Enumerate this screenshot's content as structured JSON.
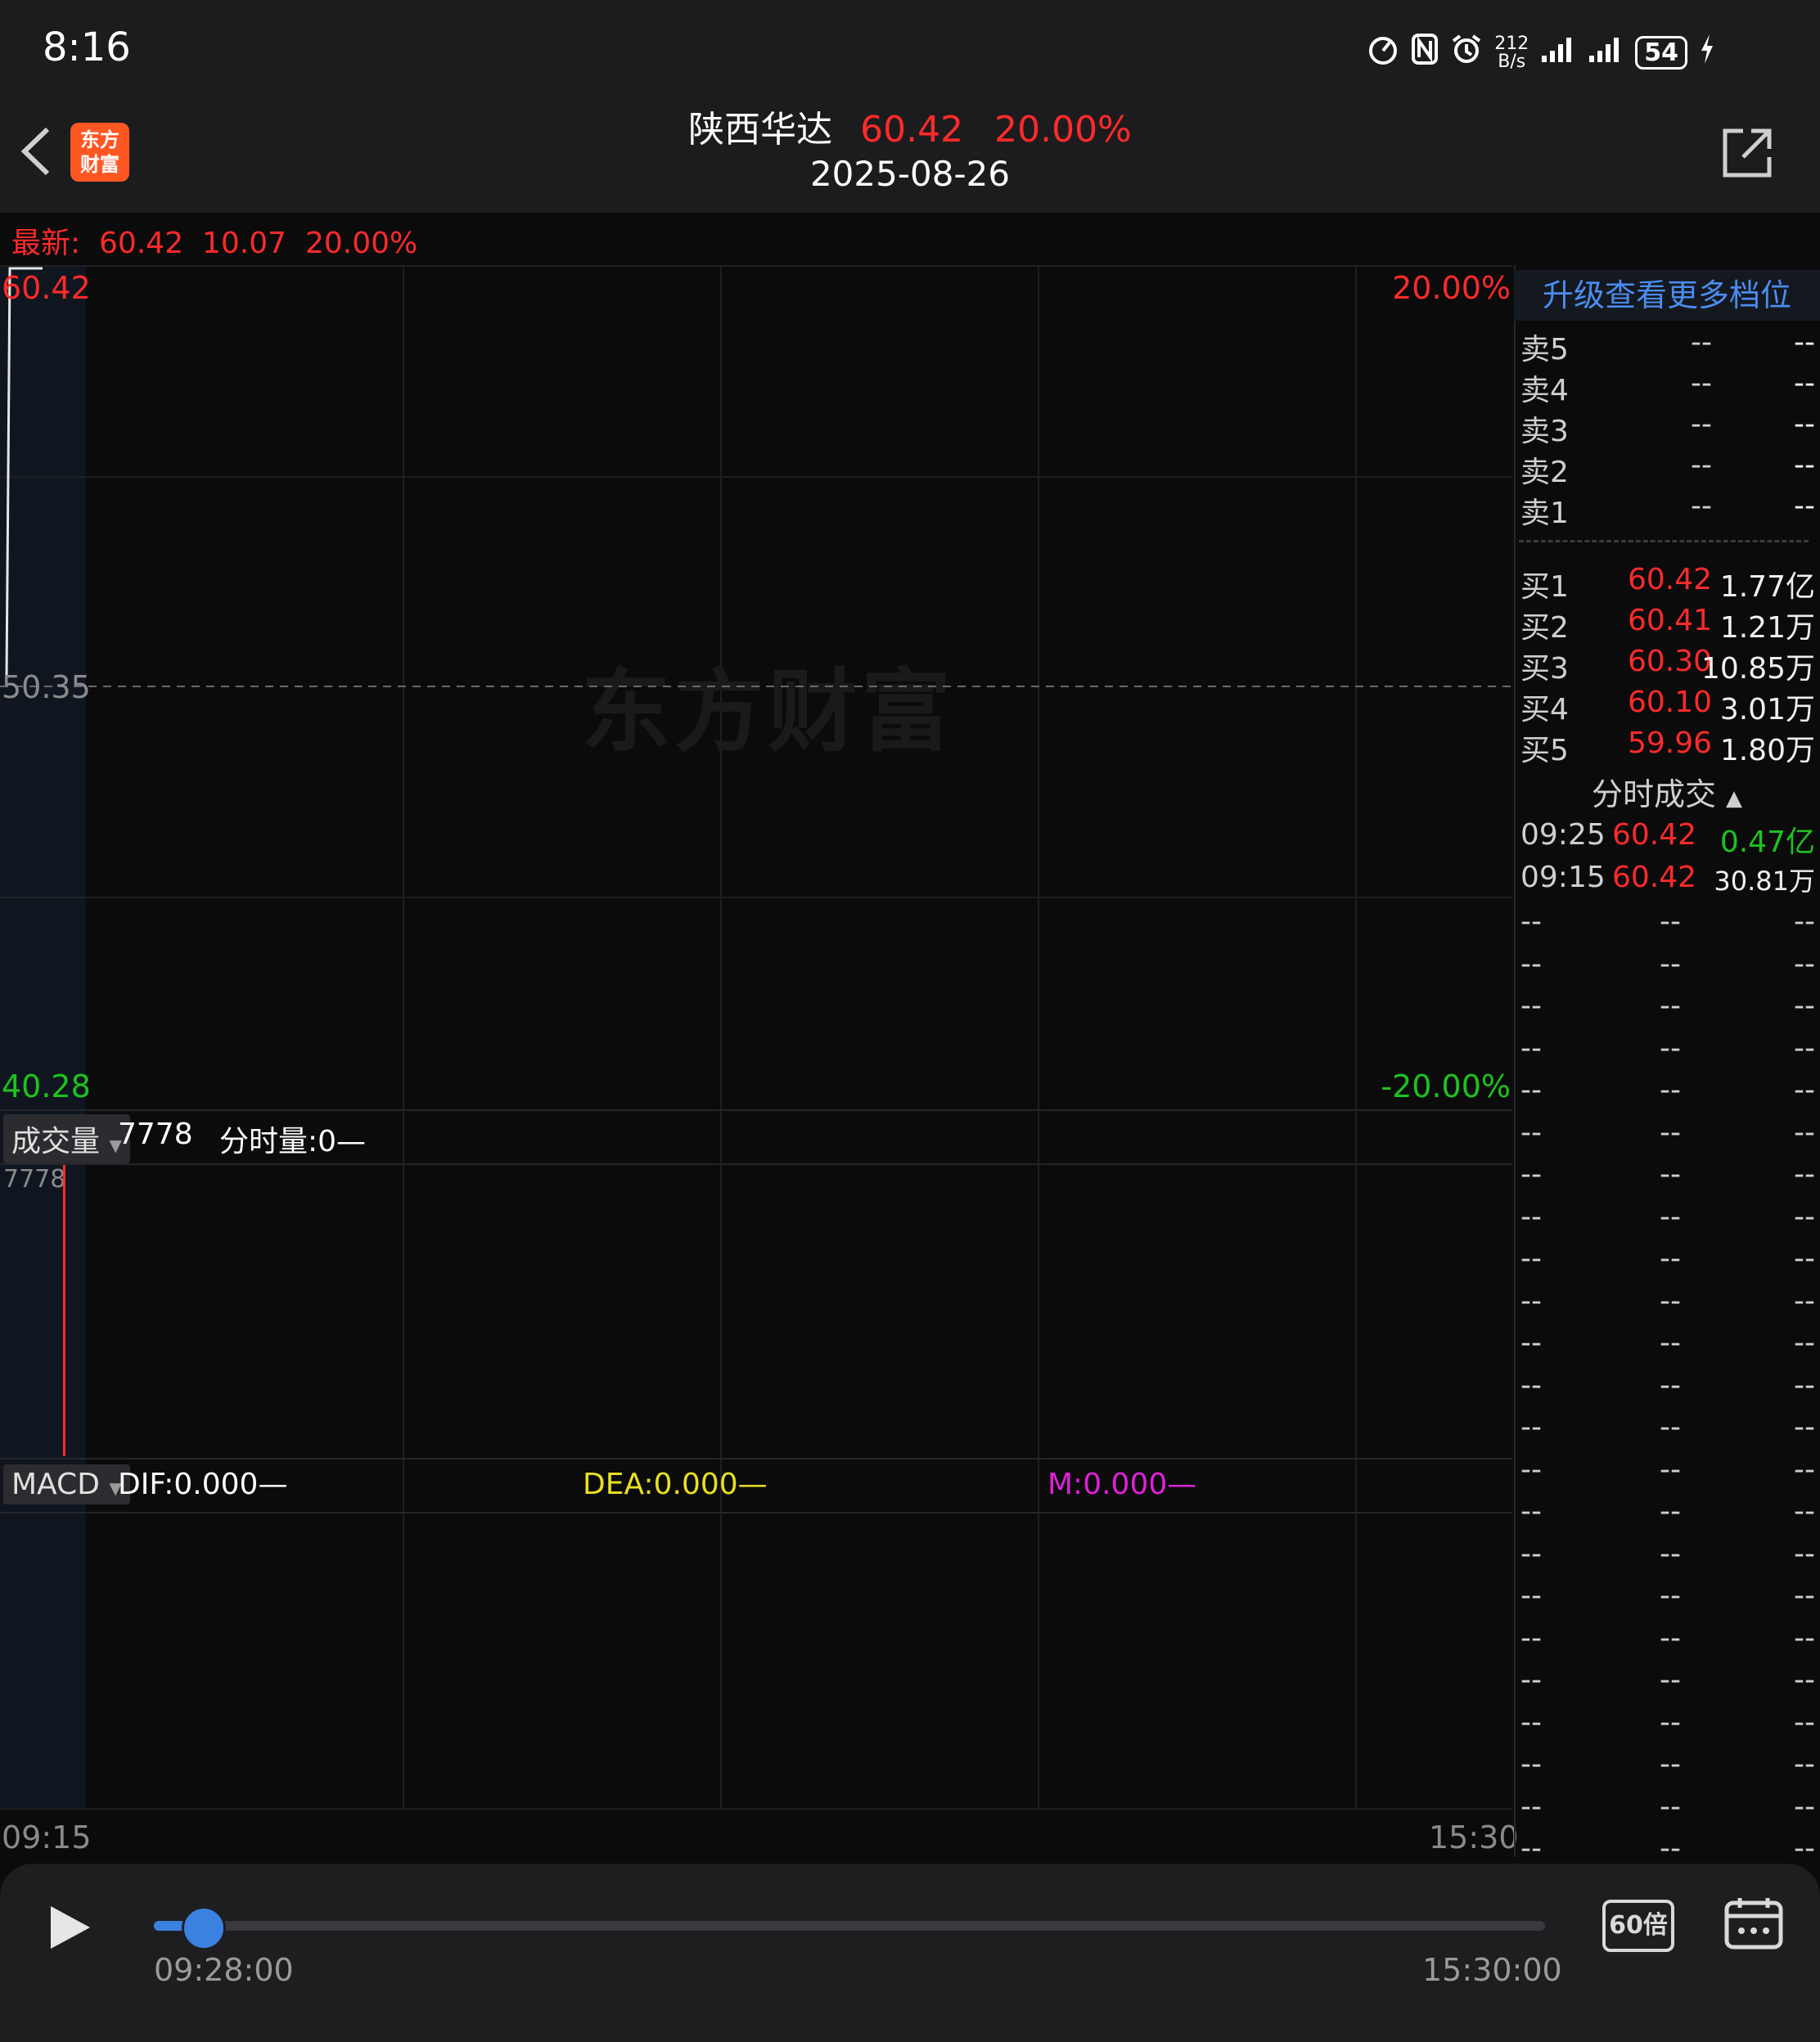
{
  "status_bar": {
    "time": "8:16",
    "net_speed_top": "212",
    "net_speed_bottom": "B/s",
    "battery": "54"
  },
  "header": {
    "stock_name": "陕西华达",
    "price": "60.42",
    "change_pct": "20.00%",
    "date": "2025-08-26",
    "logo_line1": "东方",
    "logo_line2": "财富"
  },
  "latest": {
    "label": "最新:",
    "price": "60.42",
    "change": "10.07",
    "pct": "20.00%"
  },
  "price_chart": {
    "high_label": "60.42",
    "mid_label": "50.35",
    "low_label": "40.28",
    "high_pct": "20.00%",
    "low_pct": "-20.00%",
    "watermark": "东方财富"
  },
  "volume_panel": {
    "selector": "成交量",
    "value": "7778",
    "intraday_label": "分时量:0—",
    "axis_max": "7778"
  },
  "macd_panel": {
    "selector": "MACD",
    "dif": "DIF:0.000—",
    "dea": "DEA:0.000—",
    "m": "M:0.000—"
  },
  "time_axis": {
    "start": "09:15",
    "end": "15:30"
  },
  "order_book": {
    "upgrade_text": "升级查看更多档位",
    "asks": [
      {
        "label": "卖5",
        "price": "--",
        "vol": "--"
      },
      {
        "label": "卖4",
        "price": "--",
        "vol": "--"
      },
      {
        "label": "卖3",
        "price": "--",
        "vol": "--"
      },
      {
        "label": "卖2",
        "price": "--",
        "vol": "--"
      },
      {
        "label": "卖1",
        "price": "--",
        "vol": "--"
      }
    ],
    "bids": [
      {
        "label": "买1",
        "price": "60.42",
        "vol": "1.77亿"
      },
      {
        "label": "买2",
        "price": "60.41",
        "vol": "1.21万"
      },
      {
        "label": "买3",
        "price": "60.30",
        "vol": "10.85万"
      },
      {
        "label": "买4",
        "price": "60.10",
        "vol": "3.01万"
      },
      {
        "label": "买5",
        "price": "59.96",
        "vol": "1.80万"
      }
    ]
  },
  "ticks": {
    "title": "分时成交",
    "rows": [
      {
        "time": "09:25",
        "price": "60.42",
        "vol": "0.47亿"
      },
      {
        "time": "09:15",
        "price": "60.42",
        "vol": "30.81万"
      }
    ],
    "empty": "--"
  },
  "playback": {
    "current": "09:28:00",
    "end": "15:30:00",
    "speed": "60倍",
    "progress": 0.03
  },
  "colors": {
    "up": "#ff2a2a",
    "down": "#1ec21e",
    "accent": "#3b82e0",
    "dea": "#e8e020",
    "m": "#e020d8"
  }
}
